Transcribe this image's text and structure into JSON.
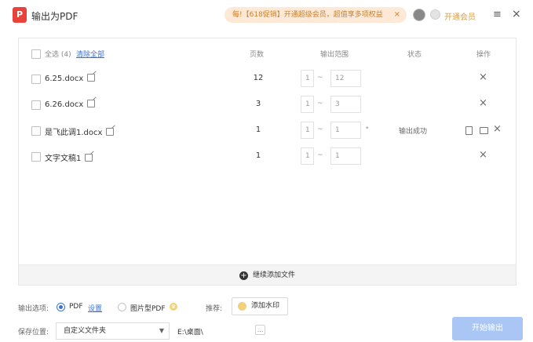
{
  "titlebar": {
    "logo": "P",
    "title": "输出为PDF",
    "promo_text": "每!【618促销】开通超级会员，超值享多项权益",
    "promo_close": "×",
    "vip_link": "开通会员",
    "menu_glyph": "≡",
    "close_glyph": "×"
  },
  "table": {
    "select_all": "全选 (4)",
    "clear_all": "清除全部",
    "headers": {
      "pages": "页数",
      "range": "输出范围",
      "status": "状态",
      "actions": "操作"
    },
    "range_separator": "~",
    "rows": [
      {
        "name": "6.25.docx",
        "pages": "12",
        "from": "1",
        "to": "12",
        "status": ""
      },
      {
        "name": "6.26.docx",
        "pages": "3",
        "from": "1",
        "to": "3",
        "status": ""
      },
      {
        "name": "是飞此调1.docx",
        "pages": "1",
        "from": "1",
        "to": "1",
        "status": "输出成功"
      },
      {
        "name": "文字文稿1",
        "pages": "1",
        "from": "1",
        "to": "1",
        "status": ""
      }
    ],
    "remove_glyph": "×",
    "add_more": "继续添加文件",
    "add_icon": "+"
  },
  "options": {
    "output_label": "输出选项:",
    "pdf_option": "PDF",
    "settings_link": "设置",
    "image_pdf_option": "图片型PDF",
    "recommend_label": "推荐:",
    "watermark_button": "添加水印",
    "save_label": "保存位置:",
    "save_select": "自定义文件夹",
    "save_path": "E:\\桌面\\",
    "more_glyph": "…",
    "start_button": "开始输出"
  },
  "colors": {
    "accent": "#3a73d8",
    "start_button": "#a9c6f5",
    "promo_bg": "#fde9d6",
    "logo": "#e8433a"
  }
}
